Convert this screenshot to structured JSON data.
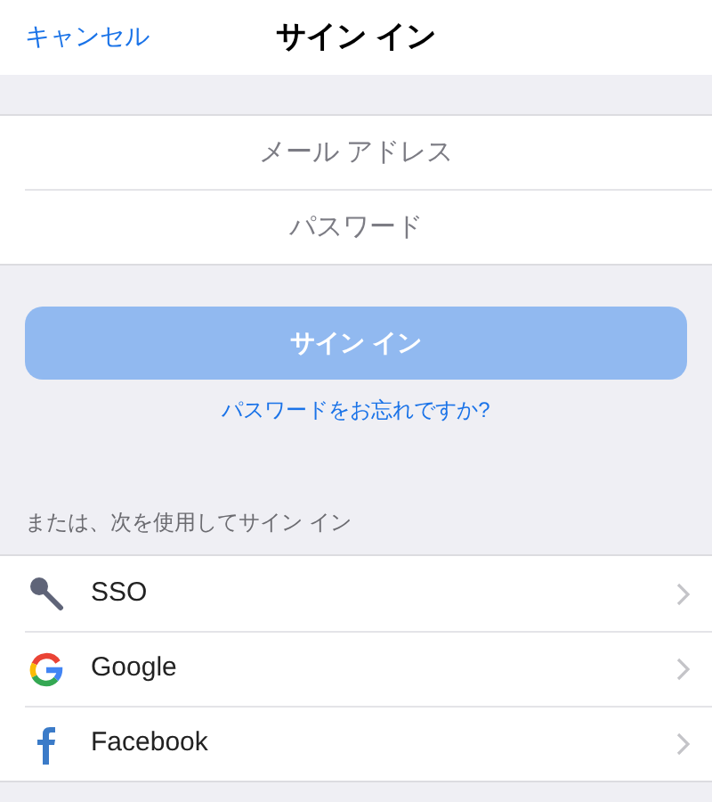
{
  "header": {
    "cancel": "キャンセル",
    "title": "サイン イン"
  },
  "fields": [
    {
      "placeholder": "メール アドレス"
    },
    {
      "placeholder": "パスワード"
    }
  ],
  "sign_in_button": {
    "label": "サイン イン",
    "disabled": true
  },
  "forgot_link": "パスワードをお忘れですか?",
  "alternatives": {
    "heading": "または、次を使用してサイン イン",
    "items": [
      {
        "kind": "key",
        "label": "SSO"
      },
      {
        "kind": "google",
        "label": "Google"
      },
      {
        "kind": "facebook",
        "label": "Facebook"
      }
    ]
  }
}
